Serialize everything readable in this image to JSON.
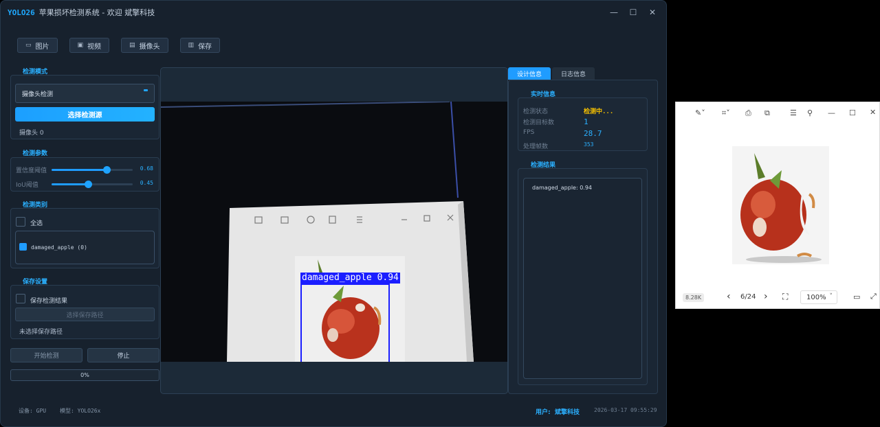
{
  "app": {
    "brand": "YOLO26",
    "title": "苹果损坏检测系统 - 欢迎 斌擎科技",
    "window_controls": [
      "—",
      "☐",
      "✕"
    ]
  },
  "toolbar": {
    "image": "图片",
    "video": "视频",
    "camera": "摄像头",
    "save": "保存"
  },
  "detect_mode": {
    "title": "检测模式",
    "selected": "摄像头检测",
    "select_source": "选择检测源",
    "camera_info": "摄像头 0"
  },
  "params": {
    "title": "检测参数",
    "conf_label": "置信度阈值",
    "conf_value": "0.68",
    "conf_fraction": 0.68,
    "iou_label": "IoU阈值",
    "iou_value": "0.45",
    "iou_fraction": 0.45
  },
  "categories": {
    "title": "检测类别",
    "select_all": "全选",
    "items": [
      {
        "label": "damaged_apple (0)",
        "checked": true
      }
    ]
  },
  "save_settings": {
    "title": "保存设置",
    "save_results": "保存检测结果",
    "choose_path": "选择保存路径",
    "path_status": "未选择保存路径"
  },
  "actions": {
    "start": "开始检测",
    "stop": "停止",
    "progress": "0%",
    "progress_fraction": 0
  },
  "detection_overlay": {
    "label": "damaged_apple 0.94"
  },
  "tabs": [
    "设计信息",
    "日志信息"
  ],
  "realtime": {
    "title": "实时信息",
    "rows": [
      {
        "key": "检测状态",
        "value": "检测中..."
      },
      {
        "key": "检测目标数",
        "value": "1"
      },
      {
        "key": "FPS",
        "value": "28.7"
      },
      {
        "key": "处理帧数",
        "value": "353"
      }
    ]
  },
  "results": {
    "title": "检测结果",
    "lines": [
      "damaged_apple: 0.94"
    ]
  },
  "status": {
    "device": "设备: GPU",
    "model": "模型: YOLO26x",
    "user_label": "用户:",
    "user_name": "斌擎科技",
    "datetime": "2026-03-17 09:55:29"
  },
  "image_viewer": {
    "file_size": "8.28K",
    "page": "6/24",
    "zoom": "100%"
  },
  "colors": {
    "accent": "#1f9cff",
    "bbox": "#1b1eff",
    "status_yellow": "#f5c000",
    "window_bg": "#17212d"
  }
}
